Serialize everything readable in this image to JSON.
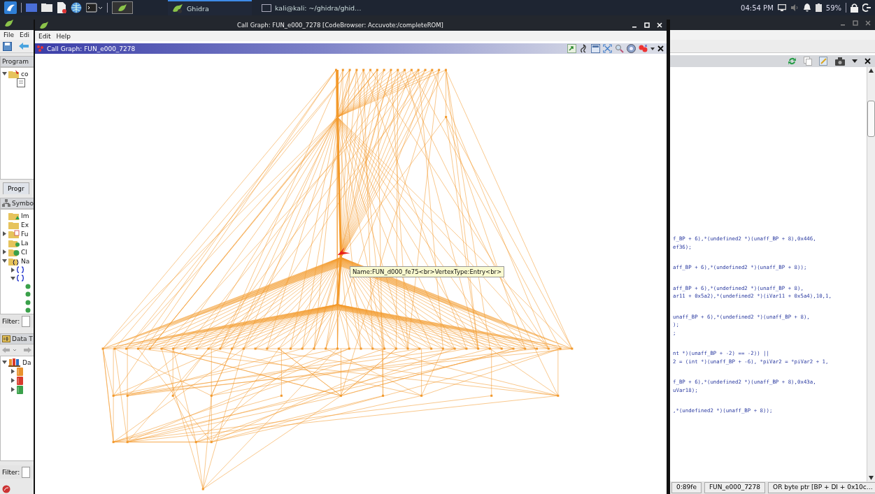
{
  "taskbar": {
    "apps": [
      {
        "label": "Ghidra",
        "selected": true
      },
      {
        "label": "kali@kali: ~/ghidra/ghid…",
        "selected": false
      }
    ],
    "clock": "04:54 PM",
    "battery": "59%"
  },
  "code_browser": {
    "menu": [
      "File",
      "Edi"
    ],
    "program_panel": {
      "title": "Program",
      "tree": [
        {
          "label": "co",
          "kind": "program",
          "expanded": true,
          "children": [
            {
              "kind": "module"
            }
          ]
        }
      ],
      "tab": "Progr"
    },
    "symbol_panel": {
      "title": "Symbo",
      "tree": [
        {
          "label": "Im",
          "kind": "imports"
        },
        {
          "label": "Ex",
          "kind": "exports"
        },
        {
          "label": "Fu",
          "kind": "functions",
          "expanded": false
        },
        {
          "label": "La",
          "kind": "labels"
        },
        {
          "label": "Cl",
          "kind": "classes",
          "expanded": false
        },
        {
          "label": "Na",
          "kind": "namespaces",
          "expanded": true,
          "children": [
            {
              "kind": "namespace",
              "expanded": false
            },
            {
              "kind": "namespace",
              "expanded": true,
              "children": [
                {
                  "kind": "symbol"
                },
                {
                  "kind": "symbol"
                },
                {
                  "kind": "symbol"
                },
                {
                  "kind": "symbol"
                }
              ]
            }
          ]
        }
      ],
      "filter_label": "Filter:"
    },
    "data_panel": {
      "title": "Data T",
      "tree": [
        {
          "label": "Da",
          "kind": "archives",
          "expanded": true,
          "children": [
            {
              "kind": "archive",
              "color": "#e8912c",
              "expanded": false
            },
            {
              "kind": "archive",
              "color": "#d83a2c",
              "expanded": false
            },
            {
              "kind": "archive",
              "color": "#3aa04a",
              "expanded": false
            }
          ]
        }
      ],
      "filter_label": "Filter:"
    },
    "code_blocks": [
      [
        "f_BP + 6),*(undefined2 *)(unaff_BP + 8),0x446,",
        "ef36);"
      ],
      [
        "aff_BP + 6),*(undefined2 *)(unaff_BP + 8));"
      ],
      [
        "aff_BP + 6),*(undefined2 *)(unaff_BP + 8),",
        "ar11 + 0x5a2),*(undefined2 *)(iVar11 + 0x5a4),10,1,"
      ],
      [
        "unaff_BP + 6),*(undefined2 *)(unaff_BP + 8),",
        ");",
        ";"
      ],
      [
        "nt *)(unaff_BP + -2) == -2)) ||",
        "2 = (int *)(unaff_BP + -6), *piVar2 = *piVar2 + 1,"
      ],
      [
        "f_BP + 6),*(undefined2 *)(unaff_BP + 8),0x43a,",
        "uVar18);"
      ],
      [
        ",*(undefined2 *)(unaff_BP + 8));"
      ]
    ],
    "status_bar": [
      "0:89fe",
      "FUN_e000_7278",
      "OR byte ptr [BP + DI + 0x10c…"
    ]
  },
  "call_graph_window": {
    "title": "Call Graph: FUN_e000_7278 [CodeBrowser: Accuvote:/completeROM]",
    "menu": [
      "Edit",
      "Help"
    ],
    "panel_title": "Call Graph: FUN_e000_7278",
    "tooltip": "Name:FUN_d000_fe75<br>VertexType:Entry<br>"
  }
}
